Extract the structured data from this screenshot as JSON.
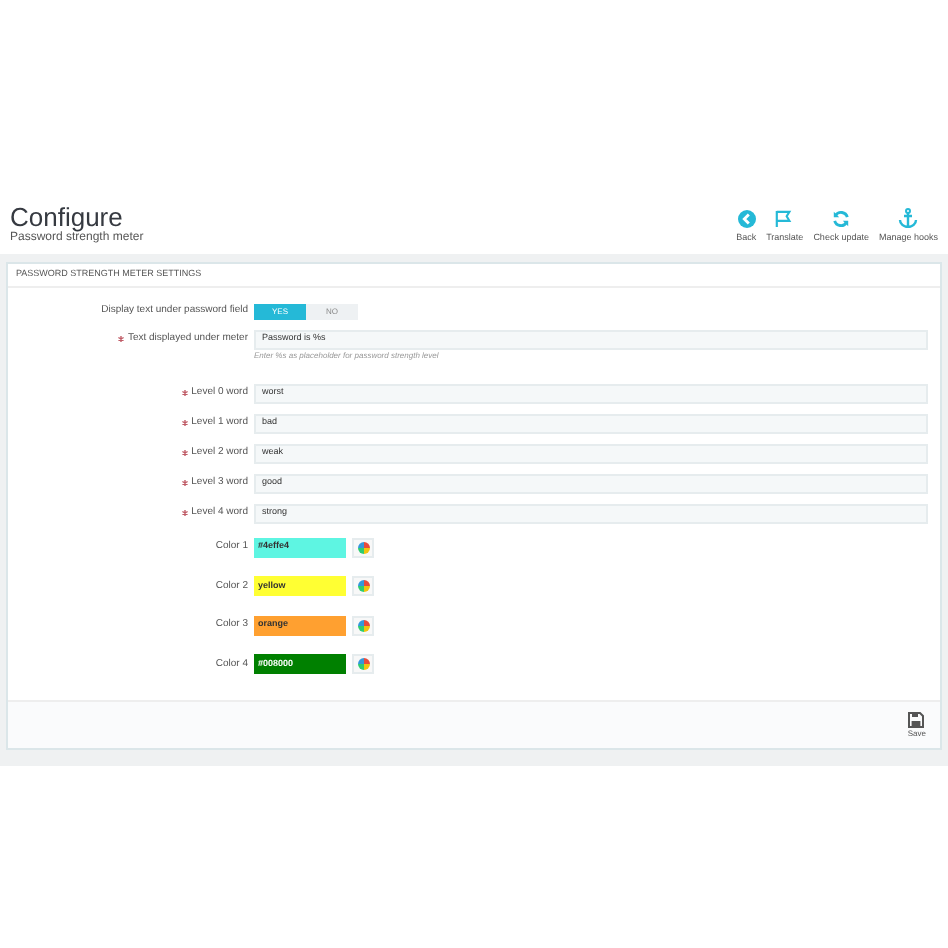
{
  "header": {
    "title": "Configure",
    "subtitle": "Password strength meter"
  },
  "toolbar": [
    {
      "kind": "back",
      "label": "Back"
    },
    {
      "kind": "flag",
      "label": "Translate"
    },
    {
      "kind": "refresh",
      "label": "Check update"
    },
    {
      "kind": "anchor",
      "label": "Manage hooks"
    }
  ],
  "panel": {
    "title": "PASSWORD STRENGTH METER SETTINGS",
    "toggle": {
      "label": "Display text under password field",
      "options": [
        {
          "label": "YES",
          "selected": true
        },
        {
          "label": "NO",
          "selected": false
        }
      ]
    },
    "text_field": {
      "label": "Text displayed under meter",
      "required": true,
      "value": "Password is %s",
      "hint": "Enter %s as placeholder for password strength level"
    },
    "levels": [
      {
        "label": "Level 0 word",
        "required": true,
        "value": "worst"
      },
      {
        "label": "Level 1 word",
        "required": true,
        "value": "bad"
      },
      {
        "label": "Level 2 word",
        "required": true,
        "value": "weak"
      },
      {
        "label": "Level 3 word",
        "required": true,
        "value": "good"
      },
      {
        "label": "Level 4 word",
        "required": true,
        "value": "strong"
      }
    ],
    "colors": [
      {
        "label": "Color 1",
        "value": "#4effe4",
        "color": "#5ef5e2"
      },
      {
        "label": "Color 2",
        "value": "yellow",
        "color": "#ffff33"
      },
      {
        "label": "Color 3",
        "value": "orange",
        "color": "#ffa030"
      },
      {
        "label": "Color 4",
        "value": "#008000",
        "color": "#008000"
      }
    ],
    "save": "Save"
  }
}
